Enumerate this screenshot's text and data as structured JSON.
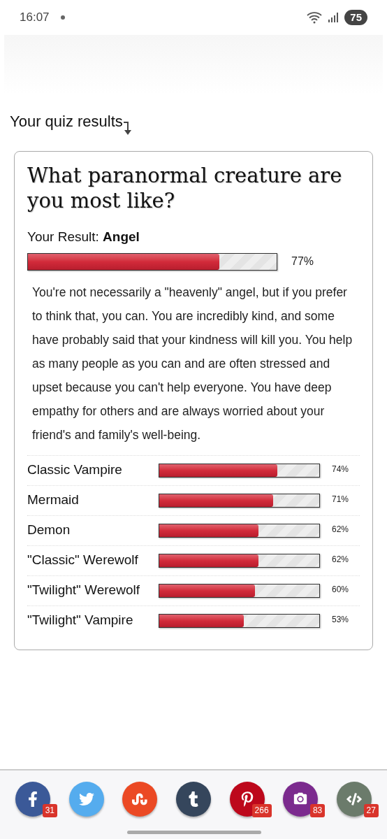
{
  "status_bar": {
    "time": "16:07",
    "battery": "75"
  },
  "heading": "Your quiz results",
  "quiz": {
    "title": "What paranormal creature are you most like?",
    "result_label": "Your Result:",
    "result": "Angel",
    "level": 0.77,
    "reading": "77%",
    "description": "You're not necessarily a \"heavenly\" angel, but if you prefer to think that, you can. You are incredibly kind, and some have probably said that your kindness will kill you. You help as many people as you can and are often stressed and upset because you can't help everyone. You have deep empathy for others and are always worried about your friend's and family's well-being.",
    "others": [
      {
        "name": "Classic Vampire",
        "level": 0.74,
        "reading": "74%"
      },
      {
        "name": "Mermaid",
        "level": 0.71,
        "reading": "71%"
      },
      {
        "name": "Demon",
        "level": 0.62,
        "reading": "62%"
      },
      {
        "name": "\"Classic\" Werewolf",
        "level": 0.62,
        "reading": "62%"
      },
      {
        "name": "\"Twilight\" Werewolf",
        "level": 0.6,
        "reading": "60%"
      },
      {
        "name": "\"Twilight\" Vampire",
        "level": 0.53,
        "reading": "53%"
      }
    ]
  },
  "share": [
    {
      "kind": "facebook",
      "color": "#3b5998",
      "count": "31"
    },
    {
      "kind": "twitter",
      "color": "#55acee"
    },
    {
      "kind": "stumbleupon",
      "color": "#eb4924"
    },
    {
      "kind": "tumblr",
      "color": "#35465c"
    },
    {
      "kind": "pinterest",
      "color": "#bd081c",
      "count": "266"
    },
    {
      "kind": "screenshot",
      "color": "#7b2a8e",
      "count": "83"
    },
    {
      "kind": "embed",
      "color": "#6b7b6b",
      "count": "27"
    }
  ]
}
